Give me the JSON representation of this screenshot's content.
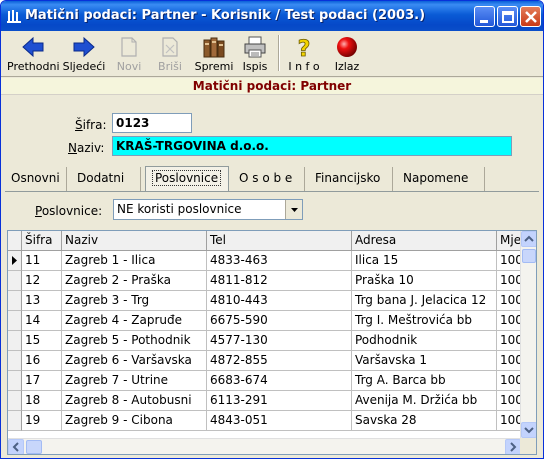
{
  "window": {
    "title": "Matični podaci: Partner - Korisnik / Test podaci (2003.)"
  },
  "toolbar": {
    "items": [
      {
        "label": "Prethodni",
        "icon": "arrow-left-icon",
        "enabled": true
      },
      {
        "label": "Sljedeći",
        "icon": "arrow-right-icon",
        "enabled": true
      },
      {
        "label": "Novi",
        "icon": "new-icon",
        "enabled": false
      },
      {
        "label": "Briši",
        "icon": "delete-icon",
        "enabled": false
      },
      {
        "label": "Spremi",
        "icon": "save-icon",
        "enabled": true
      },
      {
        "label": "Ispis",
        "icon": "printer-icon",
        "enabled": true
      },
      {
        "label": "I n f o",
        "icon": "help-icon",
        "enabled": true
      },
      {
        "label": "Izlaz",
        "icon": "exit-icon",
        "enabled": true
      }
    ]
  },
  "header": {
    "title": "Matični podaci: Partner"
  },
  "form": {
    "sifra_label": "Šifra:",
    "sifra_value": "0123",
    "naziv_label": "Naziv:",
    "naziv_value": "KRAŠ-TRGOVINA d.o.o."
  },
  "tabs": [
    {
      "label": "Osnovni"
    },
    {
      "label": "Dodatni"
    },
    {
      "label": "Poslovnice",
      "active": true
    },
    {
      "label": "O s o b e"
    },
    {
      "label": "Financijsko"
    },
    {
      "label": "Napomene"
    }
  ],
  "poslovnice": {
    "label": "Poslovnice:",
    "selected": "NE koristi poslovnice"
  },
  "grid": {
    "columns": [
      "Šifra",
      "Naziv",
      "Tel",
      "Adresa",
      "Mje"
    ],
    "rows": [
      [
        "11",
        "Zagreb 1 - Ilica",
        "4833-463",
        "Ilica 15",
        "100"
      ],
      [
        "12",
        "Zagreb 2 - Praška",
        "4811-812",
        "Praška 10",
        "100"
      ],
      [
        "13",
        "Zagreb 3 - Trg",
        "4810-443",
        "Trg bana J. Jelacica 12",
        "100"
      ],
      [
        "14",
        "Zagreb 4 - Zapruđe",
        "6675-590",
        "Trg I. Meštrovića bb",
        "100"
      ],
      [
        "15",
        "Zagreb 5 - Pothodnik",
        "4577-130",
        "Podhodnik",
        "100"
      ],
      [
        "16",
        "Zagreb 6 - Varšavska",
        "4872-855",
        "Varšavska 1",
        "100"
      ],
      [
        "17",
        "Zagreb 7 - Utrine",
        "6683-674",
        "Trg A. Barca bb",
        "100"
      ],
      [
        "18",
        "Zagreb 8 - Autobusni",
        "6113-291",
        "Avenija M. Držića bb",
        "100"
      ],
      [
        "19",
        "Zagreb 9 - Cibona",
        "4843-051",
        "Savska 28",
        "100"
      ]
    ]
  }
}
